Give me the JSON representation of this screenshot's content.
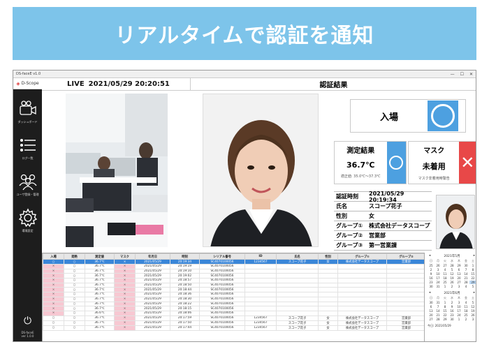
{
  "banner": {
    "title": "リアルタイムで認証を通知"
  },
  "window": {
    "title": "DS-faceE v1.0",
    "min": "—",
    "max": "☐",
    "close": "✕"
  },
  "sidebar": {
    "logo": "D-Scope",
    "items": [
      {
        "label": "ダッシュボード",
        "icon": "camera-icon"
      },
      {
        "label": "ログ一覧",
        "icon": "list-icon"
      },
      {
        "label": "ユーザ登録・管理",
        "icon": "users-icon"
      },
      {
        "label": "環境設定",
        "icon": "gear-icon"
      }
    ],
    "power_icon": "power-icon",
    "version": "DS-faceE\nver 1.0.0"
  },
  "live": {
    "label": "LIVE",
    "datetime": "2021/05/29 20:20:51"
  },
  "result": {
    "header": "認証結果",
    "entry_label": "入場",
    "measure_title": "測定結果",
    "temperature": "36.7℃",
    "temp_range": "適正値: 35.0℃〜37.3℃",
    "mask_title": "マスク",
    "mask_state": "未着用",
    "mask_warning": "マスク非着用時警告",
    "ng_mark": "✕"
  },
  "info": {
    "rows": [
      {
        "k": "認証時刻",
        "v": "2021/05/29 20:19:34"
      },
      {
        "k": "氏名",
        "v": "スコープ花子"
      },
      {
        "k": "性別",
        "v": "女"
      },
      {
        "k": "グループ①",
        "v": "株式会社データスコープ"
      },
      {
        "k": "グループ②",
        "v": "営業部"
      },
      {
        "k": "グループ③",
        "v": "第一営業課"
      }
    ]
  },
  "table": {
    "headers": [
      "入場",
      "発熱",
      "測定値",
      "マスク",
      "年月日",
      "時刻",
      "シリアル番号",
      "ID",
      "氏名",
      "性別",
      "グループ①",
      "グループ②"
    ],
    "rows": [
      [
        "○",
        "○",
        "36.7℃",
        "×",
        "2021/05/29",
        "20:19:34",
        "SC4070100056",
        "1234567",
        "スコープ花子",
        "女",
        "株式会社データスコープ",
        "営業部"
      ],
      [
        "×",
        "○",
        "36.7℃",
        "×",
        "2021/05/29",
        "20:19:19",
        "SC4070100056",
        "",
        "",
        "",
        "",
        ""
      ],
      [
        "×",
        "○",
        "36.7℃",
        "×",
        "2021/05/29",
        "20:19:10",
        "SC4070100056",
        "",
        "",
        "",
        "",
        ""
      ],
      [
        "×",
        "○",
        "36.7℃",
        "×",
        "2021/05/29",
        "20:19:02",
        "SC4070100056",
        "",
        "",
        "",
        "",
        ""
      ],
      [
        "×",
        "○",
        "36.7℃",
        "×",
        "2021/05/29",
        "20:18:57",
        "SC4070100056",
        "",
        "",
        "",
        "",
        ""
      ],
      [
        "×",
        "○",
        "36.7℃",
        "×",
        "2021/05/29",
        "20:18:50",
        "SC4070100056",
        "",
        "",
        "",
        "",
        ""
      ],
      [
        "×",
        "○",
        "36.7℃",
        "×",
        "2021/05/29",
        "20:18:44",
        "SC4070100056",
        "",
        "",
        "",
        "",
        ""
      ],
      [
        "×",
        "○",
        "36.7℃",
        "×",
        "2021/05/29",
        "20:18:36",
        "SC4070100056",
        "",
        "",
        "",
        "",
        ""
      ],
      [
        "×",
        "○",
        "36.7℃",
        "×",
        "2021/05/29",
        "20:18:30",
        "SC4070100056",
        "",
        "",
        "",
        "",
        ""
      ],
      [
        "×",
        "○",
        "36.7℃",
        "×",
        "2021/05/29",
        "20:18:22",
        "SC4070100056",
        "",
        "",
        "",
        "",
        ""
      ],
      [
        "×",
        "○",
        "36.7℃",
        "×",
        "2021/05/29",
        "20:18:15",
        "SC4070100056",
        "",
        "",
        "",
        "",
        ""
      ],
      [
        "×",
        "○",
        "36.6℃",
        "×",
        "2021/05/29",
        "20:18:06",
        "SC4070100056",
        "",
        "",
        "",
        "",
        ""
      ],
      [
        "○",
        "○",
        "36.7℃",
        "×",
        "2021/05/29",
        "20:17:59",
        "SC4070100056",
        "1234567",
        "スコープ花子",
        "女",
        "株式会社データスコープ",
        "営業部"
      ],
      [
        "○",
        "○",
        "36.7℃",
        "×",
        "2021/05/29",
        "20:17:50",
        "SC4070100056",
        "1234567",
        "スコープ花子",
        "女",
        "株式会社データスコープ",
        "営業部"
      ],
      [
        "○",
        "○",
        "36.7℃",
        "×",
        "2021/05/29",
        "20:17:44",
        "SC4070100056",
        "1234567",
        "スコープ花子",
        "女",
        "株式会社データスコープ",
        "営業部"
      ]
    ]
  },
  "calendar": {
    "months": [
      {
        "title": "2021年5月",
        "dow": [
          "日",
          "月",
          "火",
          "水",
          "木",
          "金",
          "土"
        ],
        "days": [
          "25",
          "26",
          "27",
          "28",
          "29",
          "30",
          "1",
          "2",
          "3",
          "4",
          "5",
          "6",
          "7",
          "8",
          "9",
          "10",
          "11",
          "12",
          "13",
          "14",
          "15",
          "16",
          "17",
          "18",
          "19",
          "20",
          "21",
          "22",
          "23",
          "24",
          "25",
          "26",
          "27",
          "28",
          "29",
          "30",
          "31",
          "1",
          "2",
          "3",
          "4",
          "5"
        ]
      },
      {
        "title": "2021年6月",
        "dow": [
          "日",
          "月",
          "火",
          "水",
          "木",
          "金",
          "土"
        ],
        "days": [
          "30",
          "31",
          "1",
          "2",
          "3",
          "4",
          "5",
          "6",
          "7",
          "8",
          "9",
          "10",
          "11",
          "12",
          "13",
          "14",
          "15",
          "16",
          "17",
          "18",
          "19",
          "20",
          "21",
          "22",
          "23",
          "24",
          "25",
          "26",
          "27",
          "28",
          "29",
          "30",
          "1",
          "2",
          "3"
        ]
      }
    ],
    "today_label": "今日: 2021/05/29"
  }
}
